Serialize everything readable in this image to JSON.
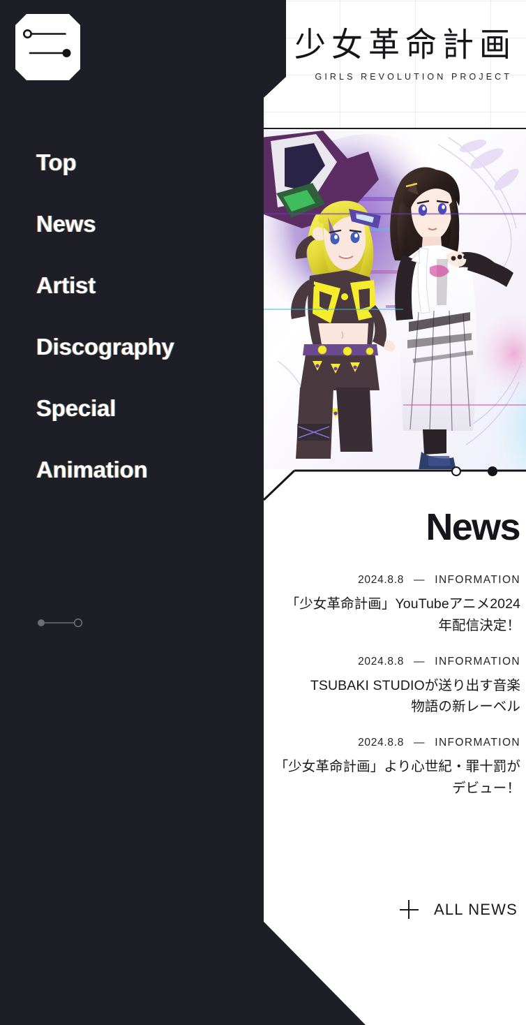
{
  "colors": {
    "dark": "#1e1e26",
    "white": "#ffffff",
    "ink": "#15151b",
    "accent_warm": "#ff8c3c",
    "accent_cool": "#5adcff"
  },
  "sidebar": {
    "menu_button": {
      "name": "menu-toggle",
      "icon": "hamburger-slider-icon"
    },
    "items": [
      {
        "label": "Top"
      },
      {
        "label": "News"
      },
      {
        "label": "Artist"
      },
      {
        "label": "Discography"
      },
      {
        "label": "Special"
      },
      {
        "label": "Animation"
      }
    ],
    "slider_indicator": {
      "icon": "slider-indicator-icon"
    }
  },
  "header": {
    "logo_jp": "少女革命計画",
    "logo_en": "GIRLS REVOLUTION PROJECT"
  },
  "hero": {
    "alt": "Two anime girls illustration with glitch artwork background",
    "carousel": {
      "dots": [
        {
          "state": "inactive"
        },
        {
          "state": "active"
        }
      ]
    }
  },
  "news": {
    "title": "News",
    "items": [
      {
        "date": "2024.8.8",
        "separator": "—",
        "category": "INFORMATION",
        "headline_lines": [
          "「少女革命計画」YouTubeアニメ2024",
          "年配信決定！"
        ]
      },
      {
        "date": "2024.8.8",
        "separator": "—",
        "category": "INFORMATION",
        "headline_lines": [
          "TSUBAKI STUDIOが送り出す音楽",
          "物語の新レーベル"
        ]
      },
      {
        "date": "2024.8.8",
        "separator": "—",
        "category": "INFORMATION",
        "headline_lines": [
          "「少女革命計画」より心世紀・罪十罰が",
          "デビュー！"
        ]
      }
    ],
    "all_news_label": "ALL NEWS"
  }
}
